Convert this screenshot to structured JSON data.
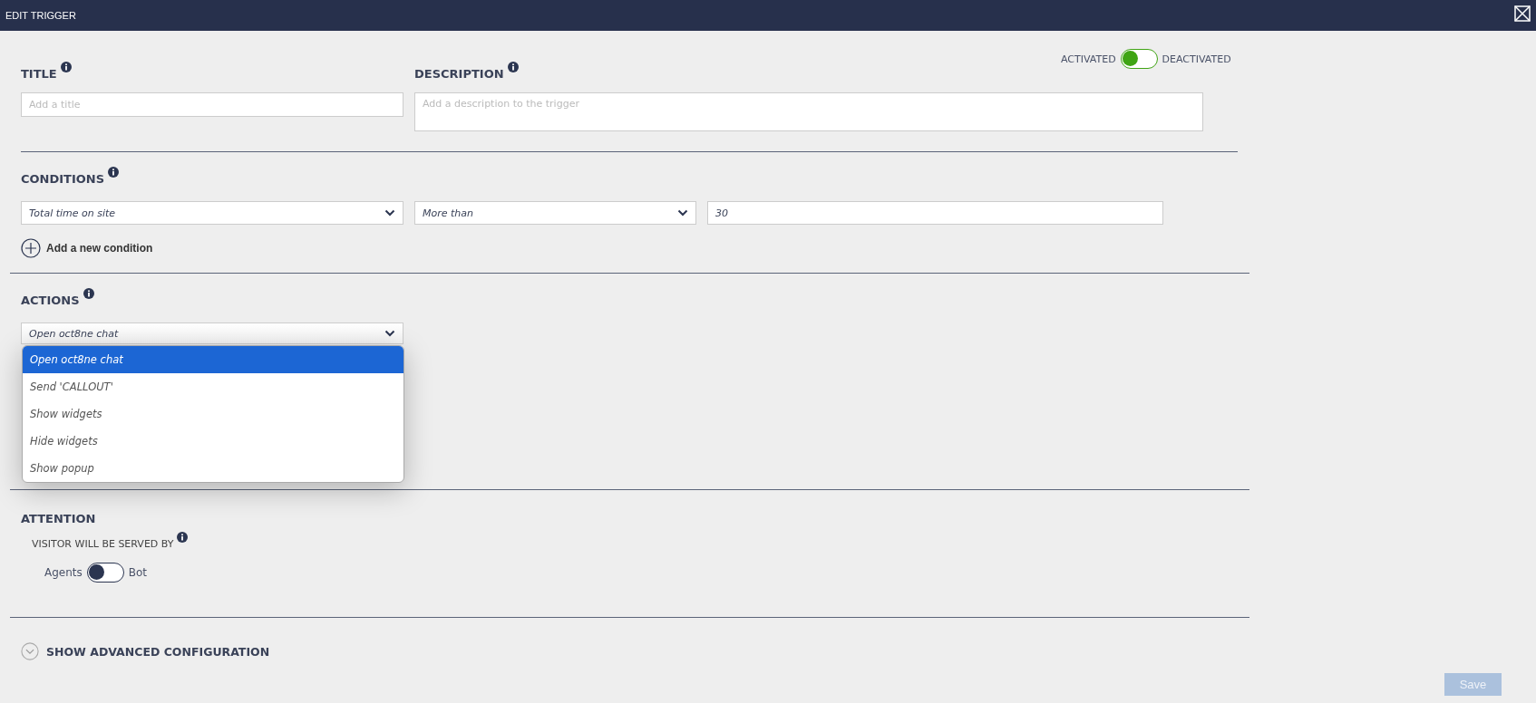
{
  "window": {
    "title": "EDIT TRIGGER"
  },
  "status_toggle": {
    "left_label": "ACTIVATED",
    "right_label": "DEACTIVATED",
    "deactivated": false
  },
  "title_field": {
    "label": "TITLE",
    "placeholder": "Add a title"
  },
  "description_field": {
    "label": "DESCRIPTION",
    "placeholder": "Add a description to the trigger"
  },
  "conditions": {
    "label": "CONDITIONS",
    "rows": [
      {
        "field": "Total time on site",
        "operator": "More than",
        "value": "30"
      }
    ],
    "add_label": "Add a new condition"
  },
  "actions": {
    "label": "ACTIONS",
    "select": {
      "value": "Open oct8ne chat",
      "expanded": true
    },
    "options": [
      {
        "label": "Open oct8ne chat",
        "selected": true
      },
      {
        "label": "Send 'CALLOUT'",
        "selected": false
      },
      {
        "label": "Show widgets",
        "selected": false
      },
      {
        "label": "Hide widgets",
        "selected": false
      },
      {
        "label": "Show popup",
        "selected": false
      }
    ]
  },
  "attention": {
    "label": "ATTENTION",
    "served_by_label": "VISITOR WILL BE SERVED BY",
    "toggle": {
      "left_label": "Agents",
      "right_label": "Bot",
      "bot": false
    }
  },
  "advanced": {
    "label": "SHOW ADVANCED CONFIGURATION",
    "expanded": false
  },
  "save_button": {
    "label": "Save",
    "disabled": true
  }
}
